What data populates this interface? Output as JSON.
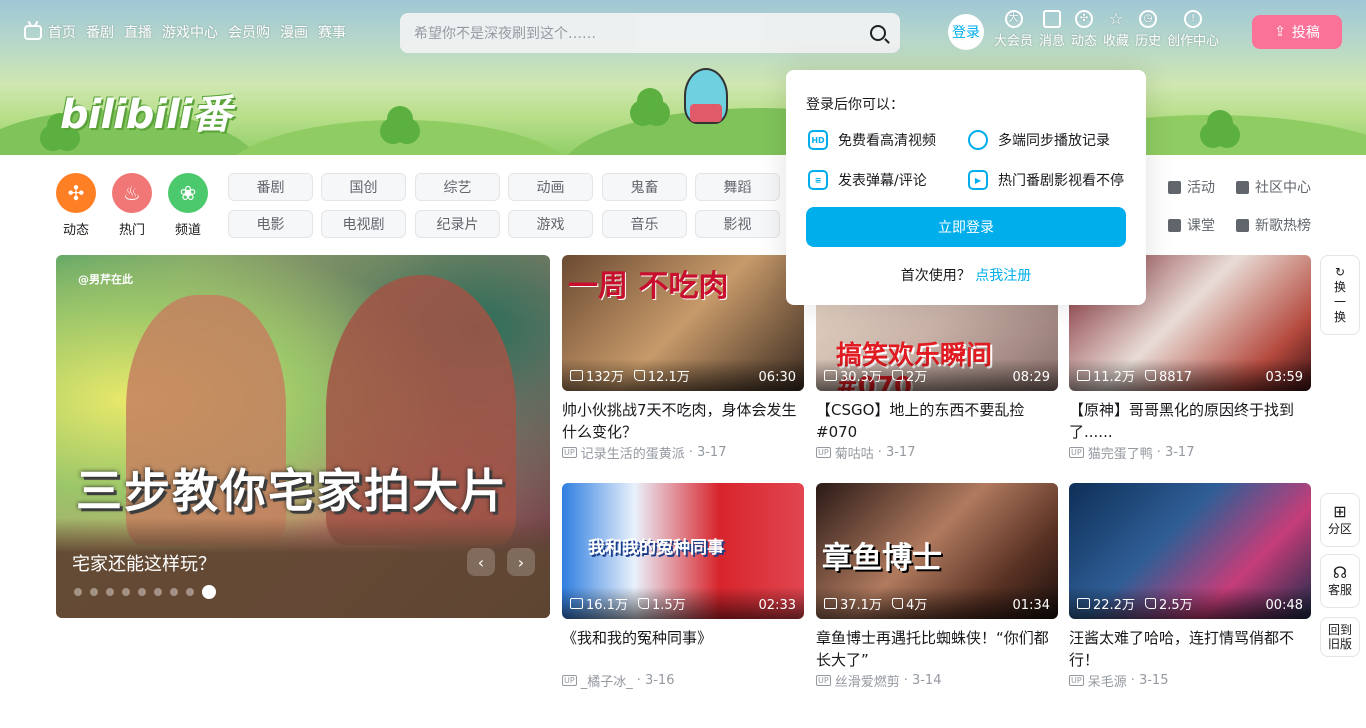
{
  "nav": {
    "items": [
      "首页",
      "番剧",
      "直播",
      "游戏中心",
      "会员购",
      "漫画",
      "赛事"
    ]
  },
  "search": {
    "placeholder": "希望你不是深夜刷到这个……"
  },
  "header": {
    "login": "登录",
    "icons": [
      "大会员",
      "消息",
      "动态",
      "收藏",
      "历史",
      "创作中心"
    ],
    "upload": "投稿",
    "logo": "bilibili番"
  },
  "categories": {
    "big": [
      "动态",
      "热门",
      "频道"
    ],
    "pills": [
      "番剧",
      "国创",
      "综艺",
      "动画",
      "鬼畜",
      "舞蹈",
      "电影",
      "电视剧",
      "纪录片",
      "游戏",
      "音乐",
      "影视"
    ],
    "extra": [
      "活动",
      "社区中心",
      "课堂",
      "新歌热榜"
    ]
  },
  "carousel": {
    "tag": "@男芹在此",
    "overlay": "三步教你宅家拍大片",
    "caption": "宅家还能这样玩？",
    "prev": "‹",
    "next": "›"
  },
  "videos": [
    {
      "views": "132万",
      "likes": "12.1万",
      "duration": "06:30",
      "title": "帅小伙挑战7天不吃肉，身体会发生什么变化？",
      "author": "记录生活的蛋黄派",
      "date": "· 3-17",
      "overlay": "一周 不吃肉"
    },
    {
      "views": "30.3万",
      "likes": "2万",
      "duration": "08:29",
      "title": "【CSGO】地上的东西不要乱捡 #070",
      "author": "菊咕咕",
      "date": "· 3-17",
      "overlay": "搞笑欢乐瞬间 #070"
    },
    {
      "views": "11.2万",
      "likes": "8817",
      "duration": "03:59",
      "title": "【原神】哥哥黑化的原因终于找到了......",
      "author": "猫完蛋了鸭",
      "date": "· 3-17",
      "overlay": ""
    },
    {
      "views": "16.1万",
      "likes": "1.5万",
      "duration": "02:33",
      "title": "《我和我的冤种同事》",
      "author": "_橘子冰_",
      "date": "· 3-16",
      "overlay": "我和我的冤种同事"
    },
    {
      "views": "37.1万",
      "likes": "4万",
      "duration": "01:34",
      "title": "章鱼博士再遇托比蜘蛛侠！“你们都长大了”",
      "author": "丝滑爱燃剪",
      "date": "· 3-14",
      "overlay": "章鱼博士"
    },
    {
      "views": "22.2万",
      "likes": "2.5万",
      "duration": "00:48",
      "title": "汪酱太难了哈哈，连打情骂俏都不行！",
      "author": "呆毛源",
      "date": "· 3-15",
      "overlay": ""
    }
  ],
  "side": {
    "refresh": "换一换",
    "zone": "分区",
    "service": "客服",
    "old": "回到旧版"
  },
  "popup": {
    "heading": "登录后你可以：",
    "features": [
      "免费看高清视频",
      "多端同步播放记录",
      "发表弹幕/评论",
      "热门番剧影视看不停"
    ],
    "login_button": "立即登录",
    "first_use": "首次使用？",
    "register": "点我注册"
  },
  "colors": {
    "accent": "#00aeec",
    "pink": "#fb7299",
    "orange": "#ff7f24",
    "red": "#f07775",
    "green": "#4bc96c"
  }
}
